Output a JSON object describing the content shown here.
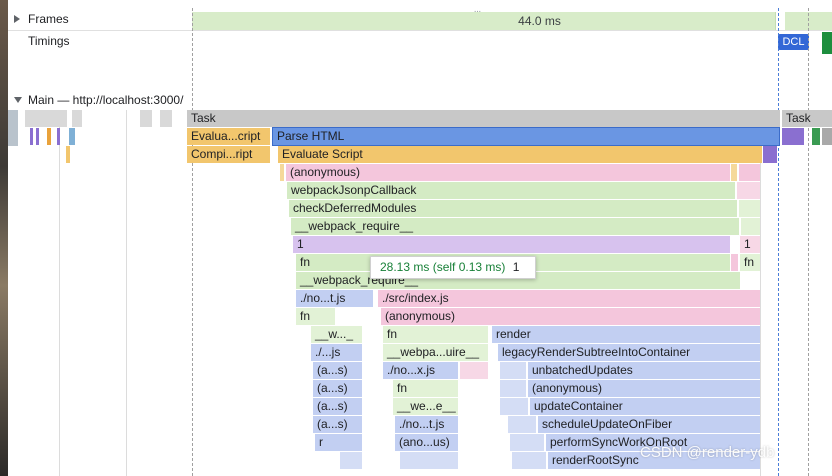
{
  "frames_track": {
    "label": "Frames",
    "frame_duration": "44.0 ms"
  },
  "timings_track": {
    "label": "Timings",
    "dcl_marker": "DCL"
  },
  "main_track": {
    "label": "Main — http://localhost:3000/"
  },
  "flame_rows": [
    [
      "Task",
      "Task"
    ],
    [
      "Evalua...cript",
      "Parse HTML"
    ],
    [
      "Compi...ript",
      "Evaluate Script"
    ],
    [
      "(anonymous)"
    ],
    [
      "webpackJsonpCallback"
    ],
    [
      "checkDeferredModules"
    ],
    [
      "__webpack_require__"
    ],
    [
      "1",
      "1"
    ],
    [
      "fn",
      "fn"
    ],
    [
      "__webpack_require__"
    ],
    [
      "./no...t.js",
      "./src/index.js"
    ],
    [
      "fn",
      "(anonymous)"
    ],
    [
      "__w..._",
      "fn",
      "render"
    ],
    [
      "./...js",
      "__webpa...uire__",
      "legacyRenderSubtreeIntoContainer"
    ],
    [
      "(a...s)",
      "./no...x.js",
      "unbatchedUpdates"
    ],
    [
      "(a...s)",
      "fn",
      "(anonymous)"
    ],
    [
      "(a...s)",
      "__we...e__",
      "updateContainer"
    ],
    [
      "(a...s)",
      "./no...t.js",
      "scheduleUpdateOnFiber"
    ],
    [
      "r",
      "(ano...us)",
      "performSyncWorkOnRoot"
    ],
    [
      "renderRootSync"
    ]
  ],
  "tooltip": {
    "duration": "28.13 ms (self 0.13 ms)",
    "name": "1"
  },
  "watermark": "CSDN @render-ydb",
  "colors": {
    "task": "#c8c8c8",
    "scripting_yellow": "#f2c66d",
    "selected_blue": "#6a96e3",
    "loading_purple": "#d7c2ee",
    "js_pink": "#f4c6dc",
    "js_green": "#d4ebc4",
    "js_blue": "#c2cff2",
    "dcl_blue": "#3367d6",
    "tooltip_duration_green": "#188038"
  }
}
